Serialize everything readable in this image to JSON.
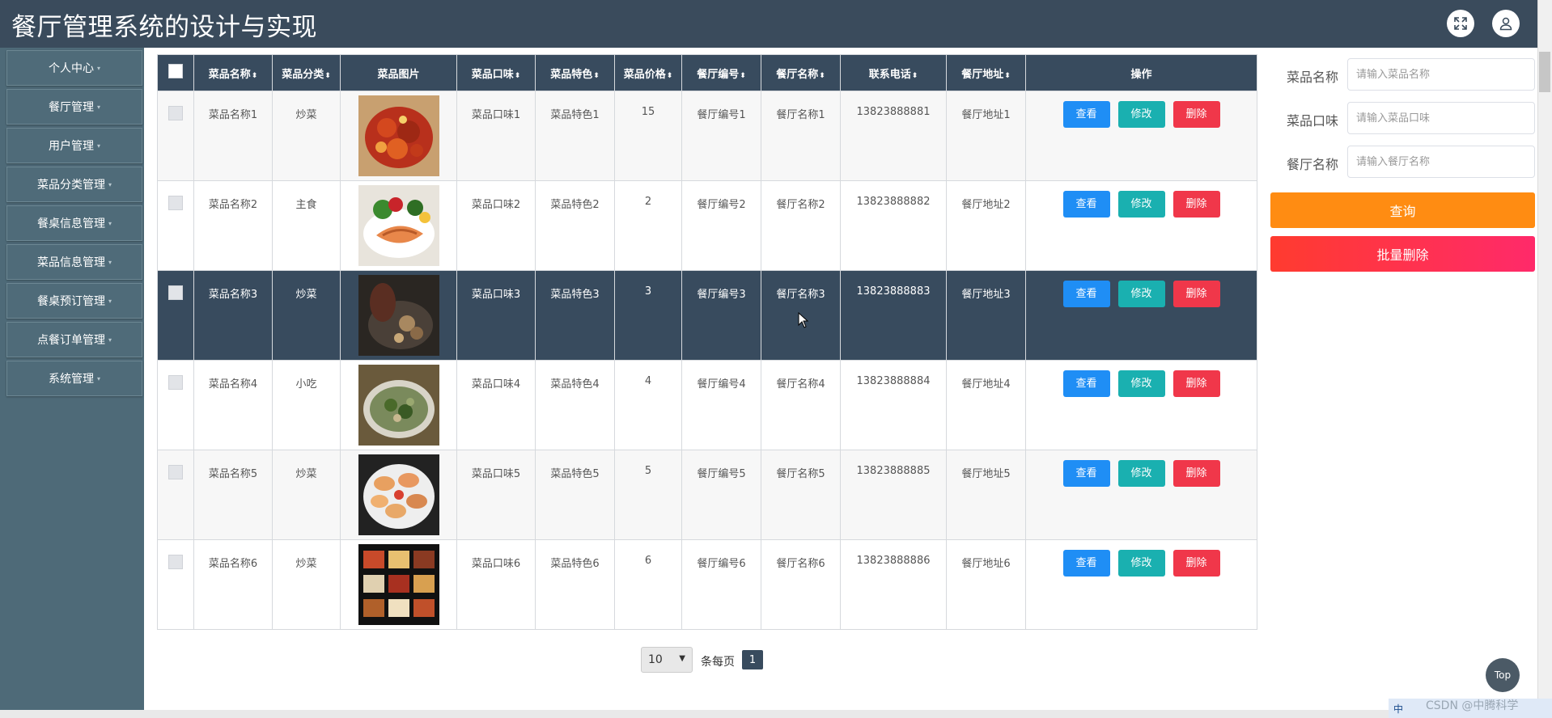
{
  "app": {
    "title": "餐厅管理系统的设计与实现"
  },
  "header": {
    "fullscreen_icon": "expand-icon",
    "user_icon": "user-icon"
  },
  "sidebar": {
    "items": [
      {
        "label": "个人中心"
      },
      {
        "label": "餐厅管理"
      },
      {
        "label": "用户管理"
      },
      {
        "label": "菜品分类管理"
      },
      {
        "label": "餐桌信息管理"
      },
      {
        "label": "菜品信息管理"
      },
      {
        "label": "餐桌预订管理"
      },
      {
        "label": "点餐订单管理"
      },
      {
        "label": "系统管理"
      }
    ]
  },
  "table": {
    "columns": [
      "菜品名称",
      "菜品分类",
      "菜品图片",
      "菜品口味",
      "菜品特色",
      "菜品价格",
      "餐厅编号",
      "餐厅名称",
      "联系电话",
      "餐厅地址",
      "操作"
    ],
    "rows": [
      {
        "name": "菜品名称1",
        "category": "炒菜",
        "taste": "菜品口味1",
        "feature": "菜品特色1",
        "price": "15",
        "code": "餐厅编号1",
        "restaurant": "餐厅名称1",
        "phone": "13823888881",
        "address": "餐厅地址1",
        "image": "dish-image-spicy-crab"
      },
      {
        "name": "菜品名称2",
        "category": "主食",
        "taste": "菜品口味2",
        "feature": "菜品特色2",
        "price": "2",
        "code": "餐厅编号2",
        "restaurant": "餐厅名称2",
        "phone": "13823888882",
        "address": "餐厅地址2",
        "image": "dish-image-salmon"
      },
      {
        "name": "菜品名称3",
        "category": "炒菜",
        "taste": "菜品口味3",
        "feature": "菜品特色3",
        "price": "3",
        "code": "餐厅编号3",
        "restaurant": "餐厅名称3",
        "phone": "13823888883",
        "address": "餐厅地址3",
        "image": "dish-image-dark-plate"
      },
      {
        "name": "菜品名称4",
        "category": "小吃",
        "taste": "菜品口味4",
        "feature": "菜品特色4",
        "price": "4",
        "code": "餐厅编号4",
        "restaurant": "餐厅名称4",
        "phone": "13823888884",
        "address": "餐厅地址4",
        "image": "dish-image-soup"
      },
      {
        "name": "菜品名称5",
        "category": "炒菜",
        "taste": "菜品口味5",
        "feature": "菜品特色5",
        "price": "5",
        "code": "餐厅编号5",
        "restaurant": "餐厅名称5",
        "phone": "13823888885",
        "address": "餐厅地址5",
        "image": "dish-image-oysters"
      },
      {
        "name": "菜品名称6",
        "category": "炒菜",
        "taste": "菜品口味6",
        "feature": "菜品特色6",
        "price": "6",
        "code": "餐厅编号6",
        "restaurant": "餐厅名称6",
        "phone": "13823888886",
        "address": "餐厅地址6",
        "image": "dish-image-bento"
      }
    ],
    "actions": {
      "view": "查看",
      "edit": "修改",
      "delete": "删除"
    }
  },
  "search": {
    "dish_name_label": "菜品名称",
    "dish_name_placeholder": "请输入菜品名称",
    "dish_taste_label": "菜品口味",
    "dish_taste_placeholder": "请输入菜品口味",
    "restaurant_name_label": "餐厅名称",
    "restaurant_name_placeholder": "请输入餐厅名称",
    "query_button": "查询",
    "batch_delete_button": "批量删除"
  },
  "pagination": {
    "page_size": "10",
    "per_page_label": "条每页",
    "current_page": "1"
  },
  "misc": {
    "top_button": "Top",
    "watermark": "CSDN @中腾科学",
    "taskbar_text": "中"
  },
  "colors": {
    "header": "#3a4b5c",
    "sidebar": "#4e6a78",
    "view": "#1f8ef5",
    "edit": "#1ab0b0",
    "delete": "#f0374a",
    "query": "#ff8c12"
  }
}
